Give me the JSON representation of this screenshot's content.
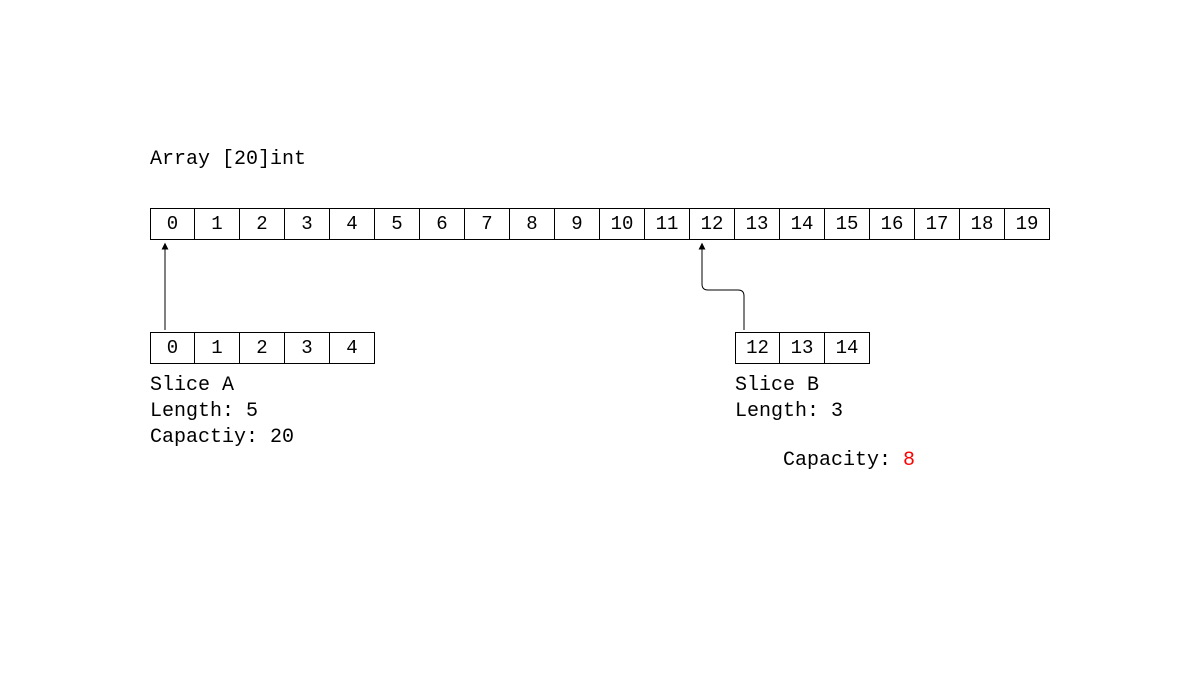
{
  "title": "Array [20]int",
  "array": [
    "0",
    "1",
    "2",
    "3",
    "4",
    "5",
    "6",
    "7",
    "8",
    "9",
    "10",
    "11",
    "12",
    "13",
    "14",
    "15",
    "16",
    "17",
    "18",
    "19"
  ],
  "sliceA": {
    "cells": [
      "0",
      "1",
      "2",
      "3",
      "4"
    ],
    "name": "Slice A",
    "lengthLabel": "Length: 5",
    "capacityLabel": "Capactiy: 20"
  },
  "sliceB": {
    "cells": [
      "12",
      "13",
      "14"
    ],
    "name": "Slice B",
    "lengthLabel": "Length: 3",
    "capacityPrefix": "Capacity: ",
    "capacityValue": "8"
  }
}
